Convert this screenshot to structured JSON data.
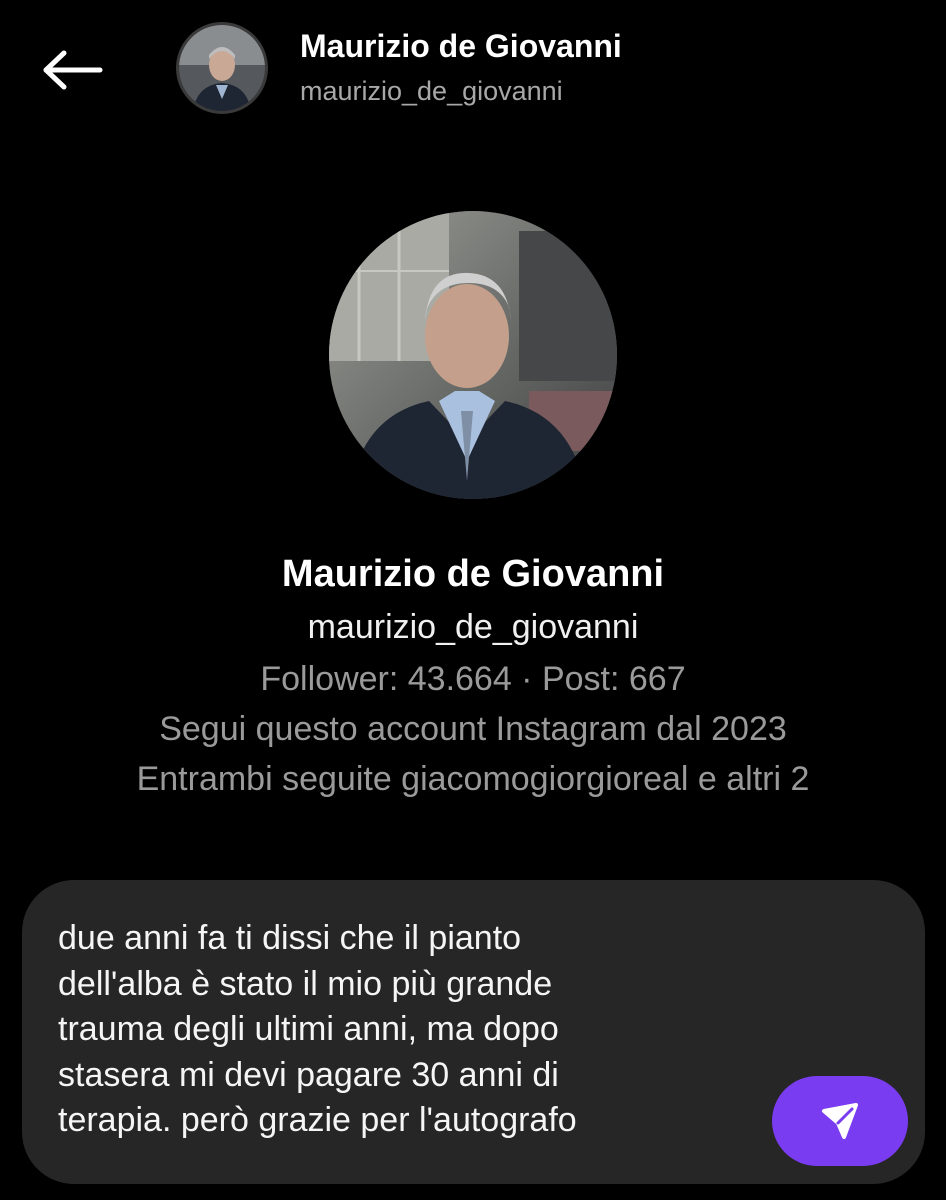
{
  "header": {
    "name": "Maurizio de Giovanni",
    "handle": "maurizio_de_giovanni",
    "back_icon": "arrow-left-icon"
  },
  "profile": {
    "name": "Maurizio de Giovanni",
    "handle": "maurizio_de_giovanni",
    "stats": "Follower: 43.664 · Post: 667",
    "follow_since": "Segui questo account Instagram dal 2023",
    "mutual": "Entrambi seguite giacomogiorgioreal e altri 2"
  },
  "composer": {
    "message": "due anni fa ti dissi che il pianto\ndell'alba è stato il mio più grande\ntrauma degli ultimi anni, ma dopo\nstasera mi devi pagare 30 anni di\nterapia. però grazie per l'autografo",
    "send_icon": "send-icon"
  },
  "colors": {
    "background": "#000000",
    "composer_bg": "#262626",
    "accent": "#7a3cf0",
    "secondary_text": "#9a9a9a"
  }
}
